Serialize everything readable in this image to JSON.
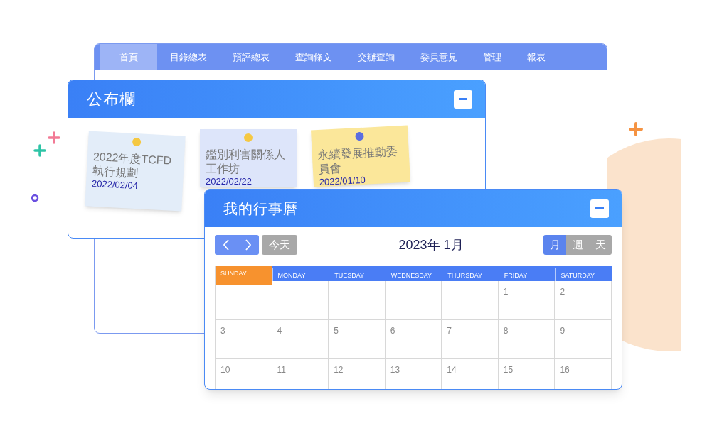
{
  "back_window": {
    "nav_tabs": [
      {
        "label": "首頁",
        "selected": true
      },
      {
        "label": "目錄總表",
        "selected": false
      },
      {
        "label": "預評總表",
        "selected": false
      },
      {
        "label": "查詢條文",
        "selected": false
      },
      {
        "label": "交辦查詢",
        "selected": false
      },
      {
        "label": "委員意見",
        "selected": false
      },
      {
        "label": "管理",
        "selected": false
      },
      {
        "label": "報表",
        "selected": false
      }
    ]
  },
  "bulletin": {
    "title": "公布欄",
    "notes": [
      {
        "title": "2022年度TCFD執行規劃",
        "date": "2022/02/04",
        "color": "#e3edf9",
        "pin": {
          "color": "#f5c842"
        }
      },
      {
        "title": "鑑別利害關係人工作坊",
        "date": "2022/02/22",
        "color": "#dde5fa",
        "pin": {
          "color": "#f5c842"
        }
      },
      {
        "title": "永續發展推動委員會",
        "date": "2022/01/10",
        "color": "#fbe79a",
        "pin": {
          "color": "#5b6ee0"
        }
      }
    ]
  },
  "calendar": {
    "title": "我的行事曆",
    "today_button": "今天",
    "month_label": "2023年 1月",
    "views": [
      {
        "label": "月",
        "selected": true
      },
      {
        "label": "週",
        "selected": false
      },
      {
        "label": "天",
        "selected": false
      }
    ],
    "weekdays": [
      {
        "label": "SUNDAY",
        "highlighted": true
      },
      {
        "label": "MONDAY",
        "highlighted": false
      },
      {
        "label": "TUESDAY",
        "highlighted": false
      },
      {
        "label": "WEDNESDAY",
        "highlighted": false
      },
      {
        "label": "THURSDAY",
        "highlighted": false
      },
      {
        "label": "FRIDAY",
        "highlighted": false
      },
      {
        "label": "SATURDAY",
        "highlighted": false
      }
    ],
    "weeks": [
      [
        {
          "day": "1"
        },
        {
          "day": "2"
        }
      ],
      [
        {
          "day": "3"
        },
        {
          "day": "4"
        },
        {
          "day": "5"
        },
        {
          "day": "6"
        },
        {
          "day": "7"
        },
        {
          "day": "8"
        },
        {
          "day": "9"
        }
      ],
      [
        {
          "day": "10"
        },
        {
          "day": "11"
        },
        {
          "day": "12"
        },
        {
          "day": "13"
        },
        {
          "day": "14"
        },
        {
          "day": "15"
        },
        {
          "day": "16"
        }
      ]
    ]
  }
}
